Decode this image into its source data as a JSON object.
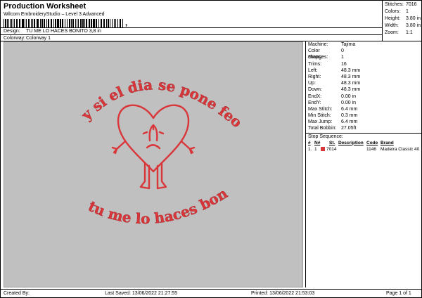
{
  "header": {
    "title": "Production Worksheet",
    "subtitle": "Wilcom EmbroideryStudio – Level 3 Advanced",
    "barcode_suffix": ",",
    "design_label": "Design:",
    "design_value": "TU ME LO HACES BONITO 3,8 in",
    "colorway_label": "Colorway:",
    "colorway_value": "Colorway 1"
  },
  "stats": [
    {
      "k": "Stitches:",
      "v": "7016"
    },
    {
      "k": "Colors:",
      "v": "1"
    },
    {
      "k": "Height:",
      "v": "3.80 in"
    },
    {
      "k": "Width:",
      "v": "3.80 in"
    },
    {
      "k": "Zoom:",
      "v": "1:1"
    }
  ],
  "details": [
    {
      "k": "Machine:",
      "v": "Tajima"
    },
    {
      "k": "Color changes:",
      "v": "0"
    },
    {
      "k": "Stops:",
      "v": "1"
    },
    {
      "k": "Trims:",
      "v": "16"
    },
    {
      "k": "Left:",
      "v": "48.3 mm"
    },
    {
      "k": "Right:",
      "v": "48.3 mm"
    },
    {
      "k": "Up:",
      "v": "48.3 mm"
    },
    {
      "k": "Down:",
      "v": "48.3 mm"
    },
    {
      "k": "EndX:",
      "v": "0.00 in"
    },
    {
      "k": "EndY:",
      "v": "0.00 in"
    },
    {
      "k": "Max Stitch:",
      "v": "6.4 mm"
    },
    {
      "k": "Min Stitch:",
      "v": "0.3 mm"
    },
    {
      "k": "Max Jump:",
      "v": "6.4 mm"
    },
    {
      "k": "Total Bobbin:",
      "v": "27.05ft"
    }
  ],
  "stop_sequence": {
    "title": "Stop Sequence:",
    "headers": [
      "#",
      "N#",
      "St.",
      "Description",
      "Code",
      "Brand"
    ],
    "rows": [
      {
        "n": "1.",
        "nn": "1",
        "st": "7014",
        "desc": "",
        "code": "1146",
        "brand": "Madeira Classic 40",
        "color": "#d9363a"
      }
    ]
  },
  "design": {
    "top_text": "y si el dia se pone feo",
    "bottom_text": "tu me lo haces bonito",
    "thread_color": "#d9363a",
    "background": "#c0c0c0"
  },
  "footer": {
    "created": "Created By:",
    "saved": "Last Saved: 13/06/2022 21:27:55",
    "printed": "Printed: 13/06/2022 21:53:03",
    "page": "Page 1 of 1"
  }
}
